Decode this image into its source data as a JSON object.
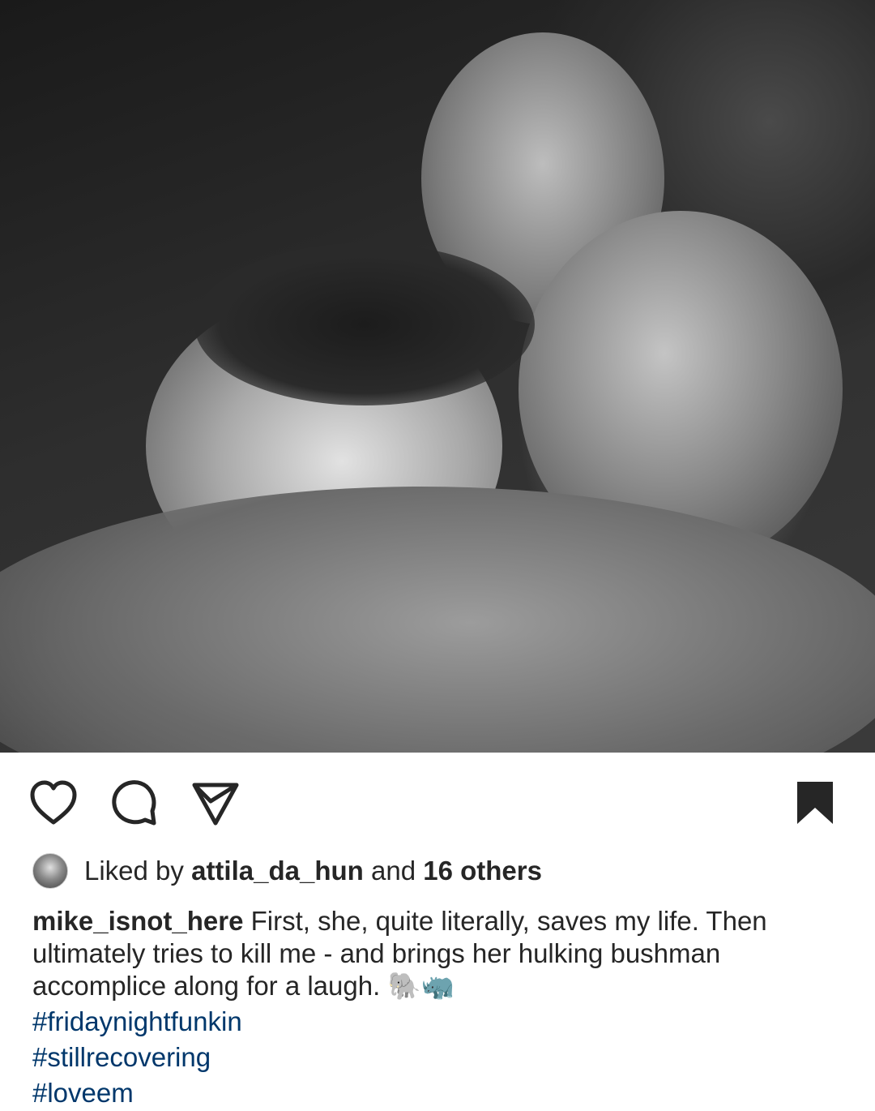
{
  "post": {
    "photo_alt": "Black and white photo of three people embracing",
    "actions": {
      "like_icon": "heart-icon",
      "comment_icon": "comment-icon",
      "share_icon": "send-icon",
      "save_icon": "bookmark-icon"
    },
    "likes": {
      "prefix": "Liked by",
      "user": "attila_da_hun",
      "connector": "and",
      "others": "16 others"
    },
    "caption": {
      "author": "mike_isnot_here",
      "text": "First, she, quite literally, saves my life. Then ultimately tries to kill me - and brings her hulking bushman accomplice along for a laugh.",
      "emoji": "🐘🦏",
      "hashtags": [
        "#fridaynightfunkin",
        "#stillrecovering",
        "#loveem"
      ]
    }
  },
  "colors": {
    "text": "#262626",
    "hashtag": "#00376b",
    "icon": "#262626"
  }
}
